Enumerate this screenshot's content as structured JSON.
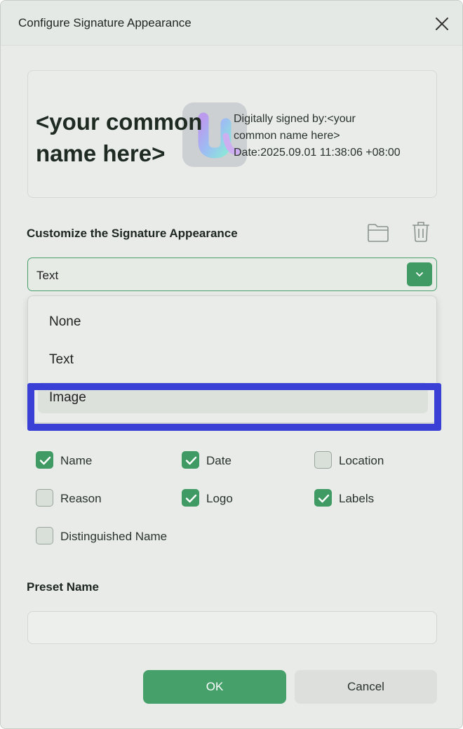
{
  "dialog": {
    "title": "Configure Signature Appearance"
  },
  "preview": {
    "name_text": "<your common name here>",
    "details_line1": "Digitally signed by:<your",
    "details_line2": "common name here>",
    "details_line3": "Date:2025.09.01 11:38:06 +08:00"
  },
  "customize": {
    "label": "Customize the Signature Appearance",
    "selected": "Text",
    "options": [
      "None",
      "Text",
      "Image"
    ]
  },
  "checkboxes": [
    {
      "label": "Name",
      "checked": true
    },
    {
      "label": "Date",
      "checked": true
    },
    {
      "label": "Location",
      "checked": false
    },
    {
      "label": "Reason",
      "checked": false
    },
    {
      "label": "Logo",
      "checked": true
    },
    {
      "label": "Labels",
      "checked": true
    },
    {
      "label": "Distinguished Name",
      "checked": false
    }
  ],
  "preset": {
    "label": "Preset Name",
    "value": "",
    "placeholder": ""
  },
  "buttons": {
    "ok": "OK",
    "cancel": "Cancel"
  },
  "colors": {
    "accent": "#3f9a63",
    "highlight": "#3a3fd6"
  }
}
